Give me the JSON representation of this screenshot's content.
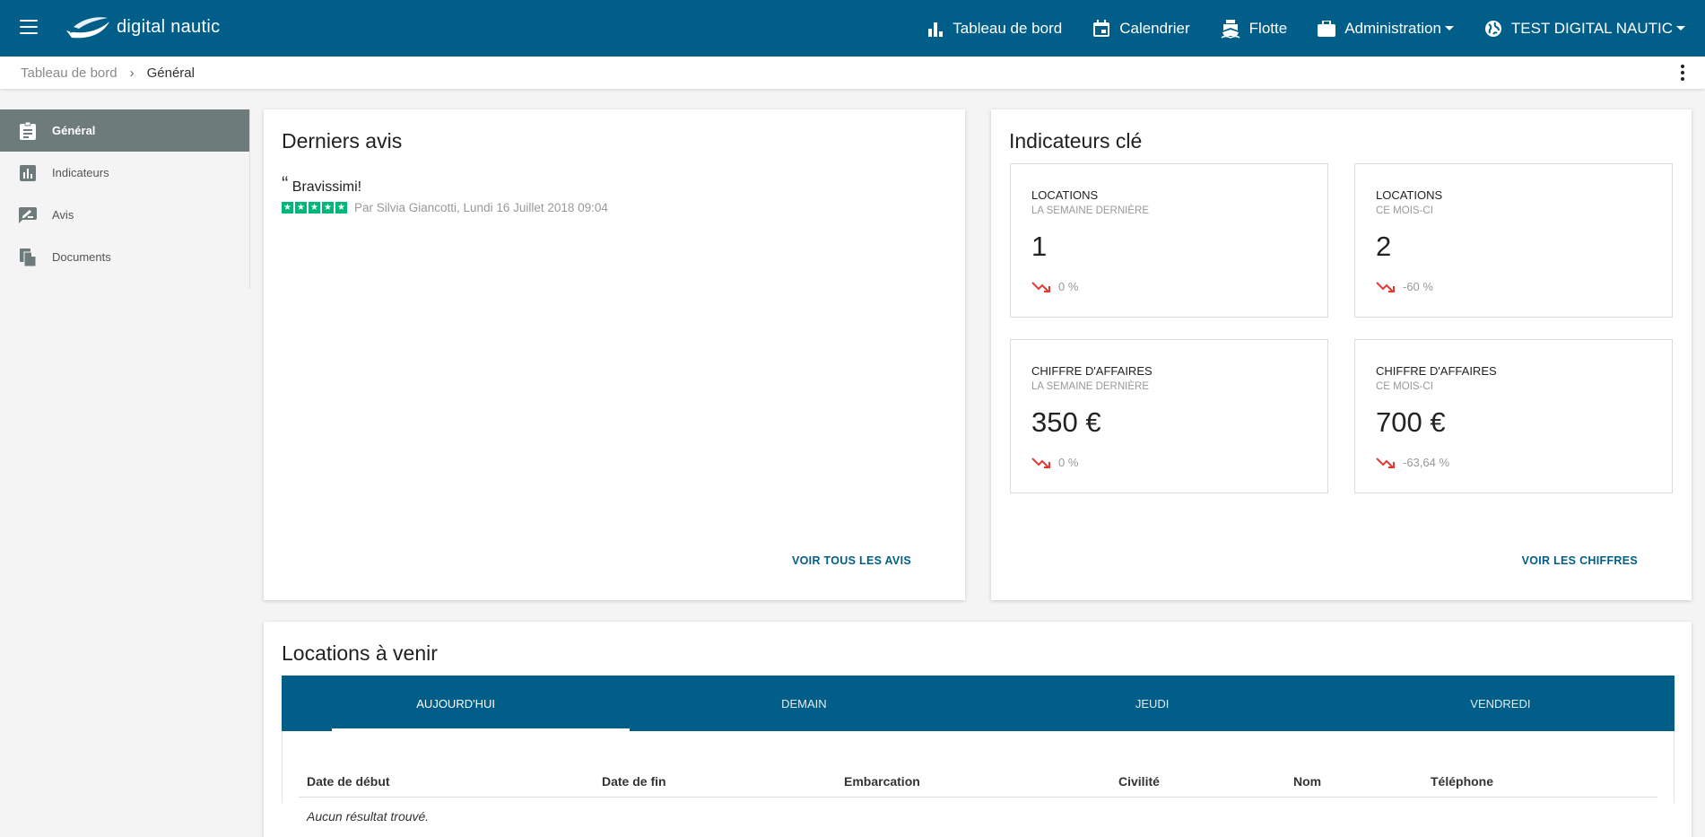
{
  "app": {
    "name": "digital nautic"
  },
  "nav": {
    "dashboard": "Tableau de bord",
    "calendar": "Calendrier",
    "fleet": "Flotte",
    "admin": "Administration",
    "account": "TEST DIGITAL NAUTIC"
  },
  "breadcrumb": {
    "parent": "Tableau de bord",
    "separator": "›",
    "current": "Général"
  },
  "sidebar": {
    "items": [
      {
        "label": "Général",
        "icon": "clipboard-icon"
      },
      {
        "label": "Indicateurs",
        "icon": "bar-chart-icon"
      },
      {
        "label": "Avis",
        "icon": "rate-review-icon"
      },
      {
        "label": "Documents",
        "icon": "documents-icon"
      }
    ]
  },
  "reviews": {
    "title": "Derniers avis",
    "quote": "“",
    "text": "Bravissimi!",
    "rating": 5,
    "author": "Par Silvia Giancotti, Lundi 16 Juillet 2018 09:04",
    "action": "VOIR TOUS LES AVIS"
  },
  "kpis": {
    "title": "Indicateurs clé",
    "action": "VOIR LES CHIFFRES",
    "items": [
      {
        "label": "LOCATIONS",
        "period": "LA SEMAINE DERNIÈRE",
        "value": "1",
        "trend": "0 %"
      },
      {
        "label": "LOCATIONS",
        "period": "CE MOIS-CI",
        "value": "2",
        "trend": "-60 %"
      },
      {
        "label": "CHIFFRE D'AFFAIRES",
        "period": "LA SEMAINE DERNIÈRE",
        "value": "350 €",
        "trend": "0 %"
      },
      {
        "label": "CHIFFRE D'AFFAIRES",
        "period": "CE MOIS-CI",
        "value": "700 €",
        "trend": "-63,64 %"
      }
    ],
    "trend_color": "#e53935"
  },
  "upcoming": {
    "title": "Locations à venir",
    "tabs": [
      "AUJOURD'HUI",
      "DEMAIN",
      "JEUDI",
      "VENDREDI"
    ],
    "columns": [
      "Date de début",
      "Date de fin",
      "Embarcation",
      "Civilité",
      "Nom",
      "Téléphone"
    ],
    "empty": "Aucun résultat trouvé."
  },
  "colors": {
    "primary": "#005e88",
    "sidebar_active": "#6d7c7b",
    "stars": "#00b67a"
  }
}
